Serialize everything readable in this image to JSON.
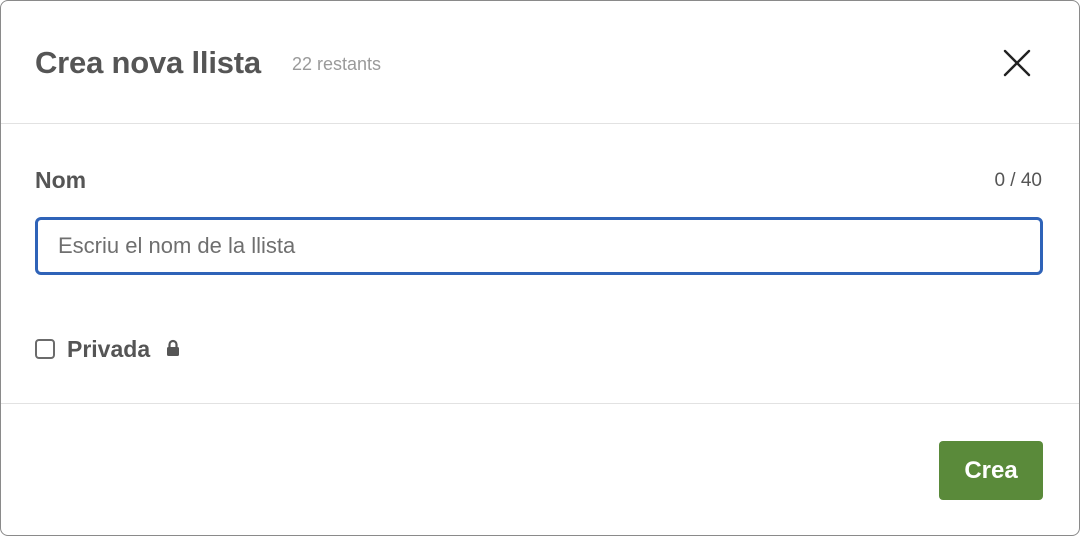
{
  "header": {
    "title": "Crea nova llista",
    "remaining": "22 restants",
    "close_icon": "close-icon"
  },
  "form": {
    "name_label": "Nom",
    "counter": "0 / 40",
    "name_value": "",
    "name_placeholder": "Escriu el nom de la llista",
    "private_label": "Privada",
    "private_checked": false,
    "lock_icon": "lock-icon"
  },
  "footer": {
    "create_label": "Crea"
  },
  "colors": {
    "primary_button": "#5a8a3a",
    "input_focus_border": "#2f63b8",
    "text": "#555555",
    "muted_text": "#9a9a9a"
  }
}
